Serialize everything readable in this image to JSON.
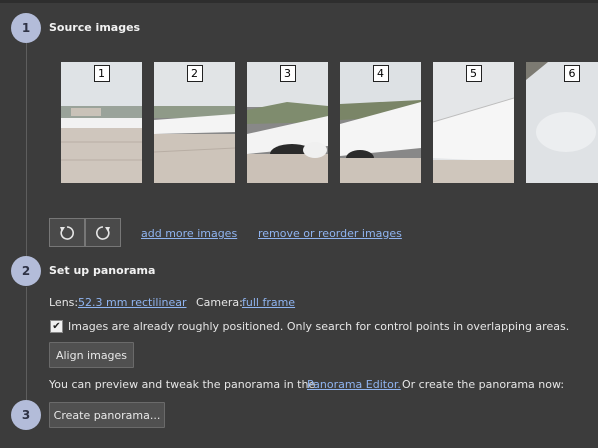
{
  "steps": [
    {
      "number": "1",
      "title": "Source images"
    },
    {
      "number": "2",
      "title": "Set up panorama"
    },
    {
      "number": "3"
    }
  ],
  "images": [
    {
      "label": "1"
    },
    {
      "label": "2"
    },
    {
      "label": "3"
    },
    {
      "label": "4"
    },
    {
      "label": "5"
    },
    {
      "label": "6"
    }
  ],
  "source": {
    "rotate_left_icon": "rotate-counterclockwise",
    "rotate_right_icon": "rotate-clockwise",
    "add_more_label": "add more images",
    "remove_reorder_label": "remove or reorder images"
  },
  "setup": {
    "lens_label": "Lens:",
    "lens_value": "52.3 mm rectilinear",
    "camera_label": "Camera:",
    "camera_value": "full frame",
    "checkbox_checked": true,
    "checkbox_label": "Images are already roughly positioned. Only search for control points in overlapping areas.",
    "align_label": "Align images",
    "preview_text_before": "You can preview and tweak the panorama in the",
    "editor_link": "Panorama Editor.",
    "preview_text_after": "Or create the panorama now:"
  },
  "create": {
    "button_label": "Create panorama..."
  },
  "colors": {
    "background": "#3c3c3c",
    "step_circle": "#b3bcd9",
    "link": "#8fb4f0"
  }
}
